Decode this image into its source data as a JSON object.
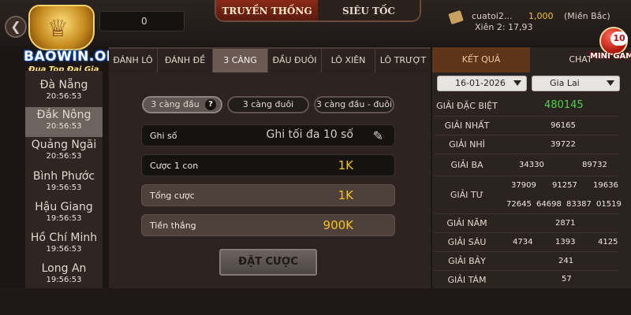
{
  "header": {
    "balance": "0",
    "mode_tabs": [
      "TRUYỀN THỐNG",
      "SIÊU TỐC"
    ],
    "user": {
      "name": "cuatoi2...",
      "xien": "Xiên 2: 17,93",
      "coins": "1,000",
      "region": "(Miền Bắc)"
    }
  },
  "logo": {
    "text": "BAOWIN.ORG",
    "tagline": "Đua Top Đại Gia"
  },
  "provinces": [
    {
      "name": "Đà Nẵng",
      "time": "20:56:53"
    },
    {
      "name": "Đắk Nông",
      "time": "20:56:53"
    },
    {
      "name": "Quảng Ngãi",
      "time": "20:56:53"
    },
    {
      "name": "Bình Phước",
      "time": "19:56:53"
    },
    {
      "name": "Hậu Giang",
      "time": "19:56:53"
    },
    {
      "name": "Hồ Chí Minh",
      "time": "19:56:53"
    },
    {
      "name": "Long An",
      "time": "19:56:53"
    }
  ],
  "bet_tabs": [
    "ĐÁNH LÔ",
    "ĐÁNH ĐỀ",
    "3 CÀNG",
    "ĐẦU ĐUÔI",
    "LÔ XIÊN",
    "LÔ TRƯỢT"
  ],
  "sub_tabs": [
    "3 càng đầu",
    "3 càng đuôi",
    "3 càng đầu - đuôi"
  ],
  "help_mark": "?",
  "form": {
    "ghi_so_label": "Ghi số",
    "ghi_so_placeholder": "Ghi tối đa 10 số",
    "cuoc_label": "Cược 1 con",
    "cuoc_value": "1K",
    "tong_label": "Tổng cược",
    "tong_value": "1K",
    "thang_label": "Tiền thắng",
    "thang_value": "900K"
  },
  "submit_label": "ĐẶT CƯỢC",
  "right_tabs": [
    "KẾT QUẢ",
    "CHAT"
  ],
  "date_select": "16-01-2026",
  "province_select": "Gia Lai",
  "results": [
    {
      "label": "GIẢI ĐẶC BIỆT",
      "values": [
        "480145"
      ]
    },
    {
      "label": "GIẢI NHẤT",
      "values": [
        "96165"
      ]
    },
    {
      "label": "GIẢI NHÌ",
      "values": [
        "39722"
      ]
    },
    {
      "label": "GIẢI BA",
      "values": [
        "34330",
        "89732"
      ]
    },
    {
      "label": "GIẢI TƯ",
      "values": [
        "37909",
        "91257",
        "19636",
        "72645",
        "64698",
        "83387",
        "01519"
      ]
    },
    {
      "label": "GIẢI NĂM",
      "values": [
        "2871"
      ]
    },
    {
      "label": "GIẢI SÁU",
      "values": [
        "4734",
        "1393",
        "4125"
      ]
    },
    {
      "label": "GIẢI BẢY",
      "values": [
        "241"
      ]
    },
    {
      "label": "GIẢI TÁM",
      "values": [
        "57"
      ]
    }
  ],
  "mini_game": {
    "badge": "10",
    "label": "MINI GAME"
  },
  "icons": {
    "back": "chevron-left-icon",
    "help": "question-icon",
    "pencil": "pencil-icon",
    "ticket": "ticket-icon",
    "caret": "caret-down-icon"
  },
  "colors": {
    "accent_gold": "#f4c21e",
    "special_prize": "#4fd14a",
    "active_tab": "#8a2a16"
  }
}
